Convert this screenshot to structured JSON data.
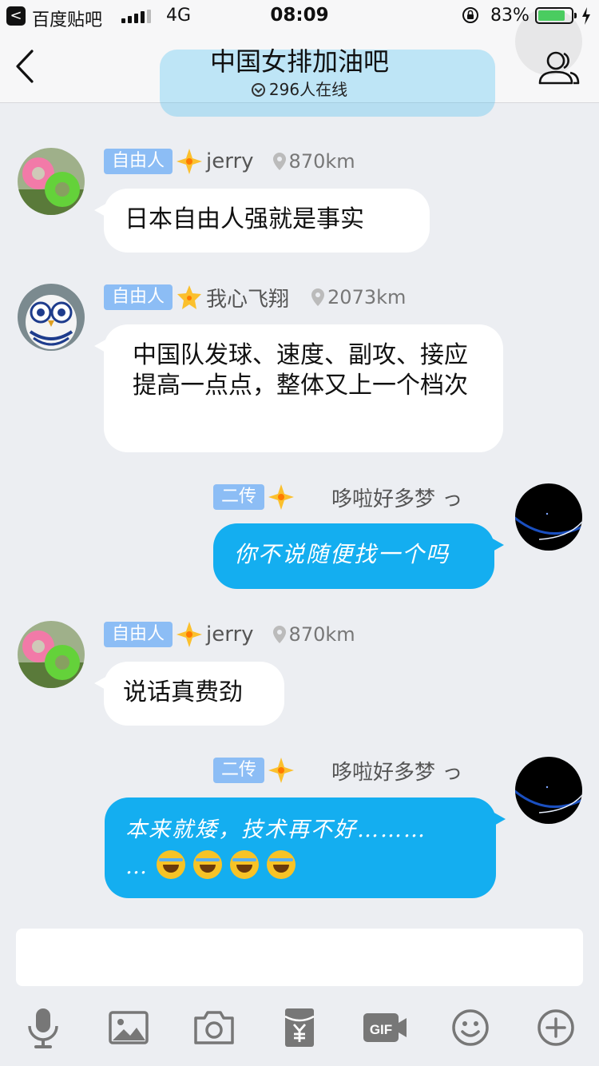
{
  "status_bar": {
    "back_app_glyph": "<",
    "app_name": "百度贴吧",
    "network": "4G",
    "time": "08:09",
    "battery_percent_text": "83%",
    "battery_level": 0.83
  },
  "header": {
    "title": "中国女排加油吧",
    "online_count": "296人在线",
    "back_icon": "chevron-left-icon",
    "members_icon": "members-icon"
  },
  "messages": [
    {
      "side": "left",
      "tag": "自由人",
      "username": "jerry",
      "distance": "870km",
      "avatar": "swim-rings-avatar",
      "text": "日本自由人强就是事实"
    },
    {
      "side": "left",
      "tag": "自由人",
      "username": "我心飞翔",
      "distance": "2073km",
      "avatar": "owl-avatar",
      "text": "中国队发球、速度、副攻、接应提高一点点，整体又上一个档次"
    },
    {
      "side": "right",
      "tag": "二传",
      "username": "哆啦好多梦 っ",
      "avatar": "dark-planet-avatar",
      "text": "你不说随便找一个吗"
    },
    {
      "side": "left",
      "tag": "自由人",
      "username": "jerry",
      "distance": "870km",
      "avatar": "swim-rings-avatar",
      "text": "说话真费劲"
    },
    {
      "side": "right",
      "tag": "二传",
      "username": "哆啦好多梦 っ",
      "avatar": "dark-planet-avatar",
      "text": "本来就矮，技术再不好………",
      "text_line2": "…",
      "emoji_count": 4
    }
  ],
  "composer": {
    "input_value": "",
    "tools": [
      "microphone-icon",
      "image-icon",
      "camera-icon",
      "red-packet-icon",
      "gif-icon",
      "emoji-icon",
      "plus-icon"
    ]
  },
  "colors": {
    "accent_blue": "#14aef0",
    "tag_blue": "#8cbdf5",
    "background": "#eceef2"
  }
}
